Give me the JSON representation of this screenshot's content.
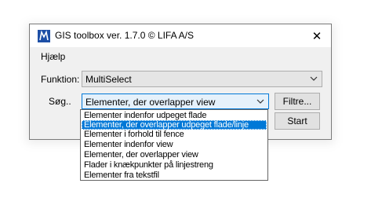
{
  "window": {
    "title": "GIS toolbox ver. 1.7.0 © LIFA A/S",
    "close_glyph": "✕",
    "icon": "lifa-app-icon"
  },
  "menu": {
    "items": [
      {
        "label": "Hjælp"
      }
    ]
  },
  "form": {
    "funktion_label": "Funktion:",
    "funktion_value": "MultiSelect",
    "sog_label": "Søg..",
    "sog_value": "Elementer, der overlapper view",
    "filter_button": "Filtre...",
    "start_button": "Start"
  },
  "dropdown": {
    "selected_index": 1,
    "options": [
      "Elementer indenfor udpeget flade",
      "Elementer, der overlapper udpeget flade/linje",
      "Elementer i forhold til fence",
      "Elementer indenfor view",
      "Elementer, der overlapper view",
      "Flader i knækpunkter på linjestreng",
      "Elementer fra tekstfil"
    ]
  },
  "colors": {
    "accent": "#0078d7",
    "title_bar": "#ffffff",
    "dialog_bg": "#f0f0f0"
  }
}
